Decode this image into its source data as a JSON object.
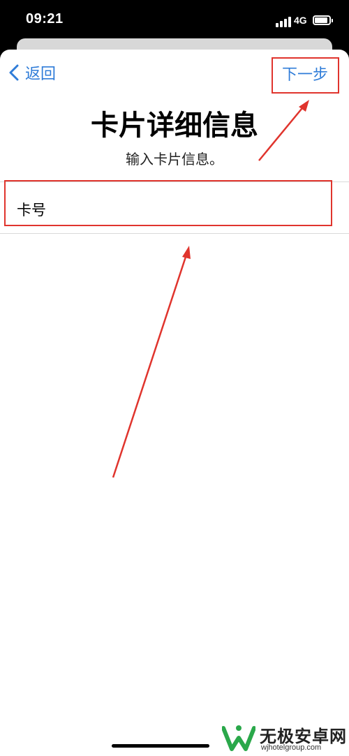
{
  "status_bar": {
    "time": "09:21",
    "network": "4G"
  },
  "nav": {
    "back_label": "返回",
    "next_label": "下一步"
  },
  "header": {
    "title": "卡片详细信息",
    "subtitle": "输入卡片信息。"
  },
  "form": {
    "card_number_label": "卡号"
  },
  "colors": {
    "link": "#2f7cd8",
    "annotation": "#e0342d"
  },
  "watermark": {
    "title": "无极安卓网",
    "url": "wjhotelgroup.com"
  }
}
